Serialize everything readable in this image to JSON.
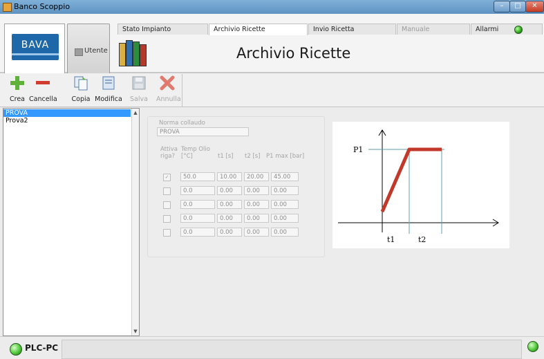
{
  "window": {
    "title": "Banco Scoppio",
    "min": "–",
    "max": "□",
    "close": "✕"
  },
  "header": {
    "logo_text": "BAVA",
    "user_button": "Utente",
    "page_title": "Archivio Ricette",
    "tabs": [
      {
        "label": "Stato Impianto"
      },
      {
        "label": "Archivio Ricette"
      },
      {
        "label": "Invio Ricetta"
      },
      {
        "label": "Manuale"
      },
      {
        "label": "Allarmi"
      }
    ]
  },
  "toolbar": {
    "crea": "Crea",
    "cancella": "Cancella",
    "copia": "Copia",
    "modifica": "Modifica",
    "salva": "Salva",
    "annulla": "Annulla"
  },
  "recipe_list": {
    "items": [
      "PROVA",
      "Prova2"
    ],
    "selected_index": 0
  },
  "form": {
    "norma_label": "Norma collaudo",
    "norma_value": "PROVA",
    "headers": {
      "attiva": "Attiva riga?",
      "temp": "Temp Olio [°C]",
      "t1": "t1 [s]",
      "t2": "t2 [s]",
      "p1": "P1 max [bar]"
    },
    "rows": [
      {
        "attiva": true,
        "temp": "50.0",
        "t1": "10.00",
        "t2": "20.00",
        "p1": "45.00"
      },
      {
        "attiva": false,
        "temp": "0.0",
        "t1": "0.00",
        "t2": "0.00",
        "p1": "0.00"
      },
      {
        "attiva": false,
        "temp": "0.0",
        "t1": "0.00",
        "t2": "0.00",
        "p1": "0.00"
      },
      {
        "attiva": false,
        "temp": "0.0",
        "t1": "0.00",
        "t2": "0.00",
        "p1": "0.00"
      },
      {
        "attiva": false,
        "temp": "0.0",
        "t1": "0.00",
        "t2": "0.00",
        "p1": "0.00"
      }
    ]
  },
  "diagram": {
    "p1": "P1",
    "t1": "t1",
    "t2": "t2",
    "curve_color": "#c0392b"
  },
  "status": {
    "label": "PLC-PC",
    "led_color": "#50c93a"
  }
}
